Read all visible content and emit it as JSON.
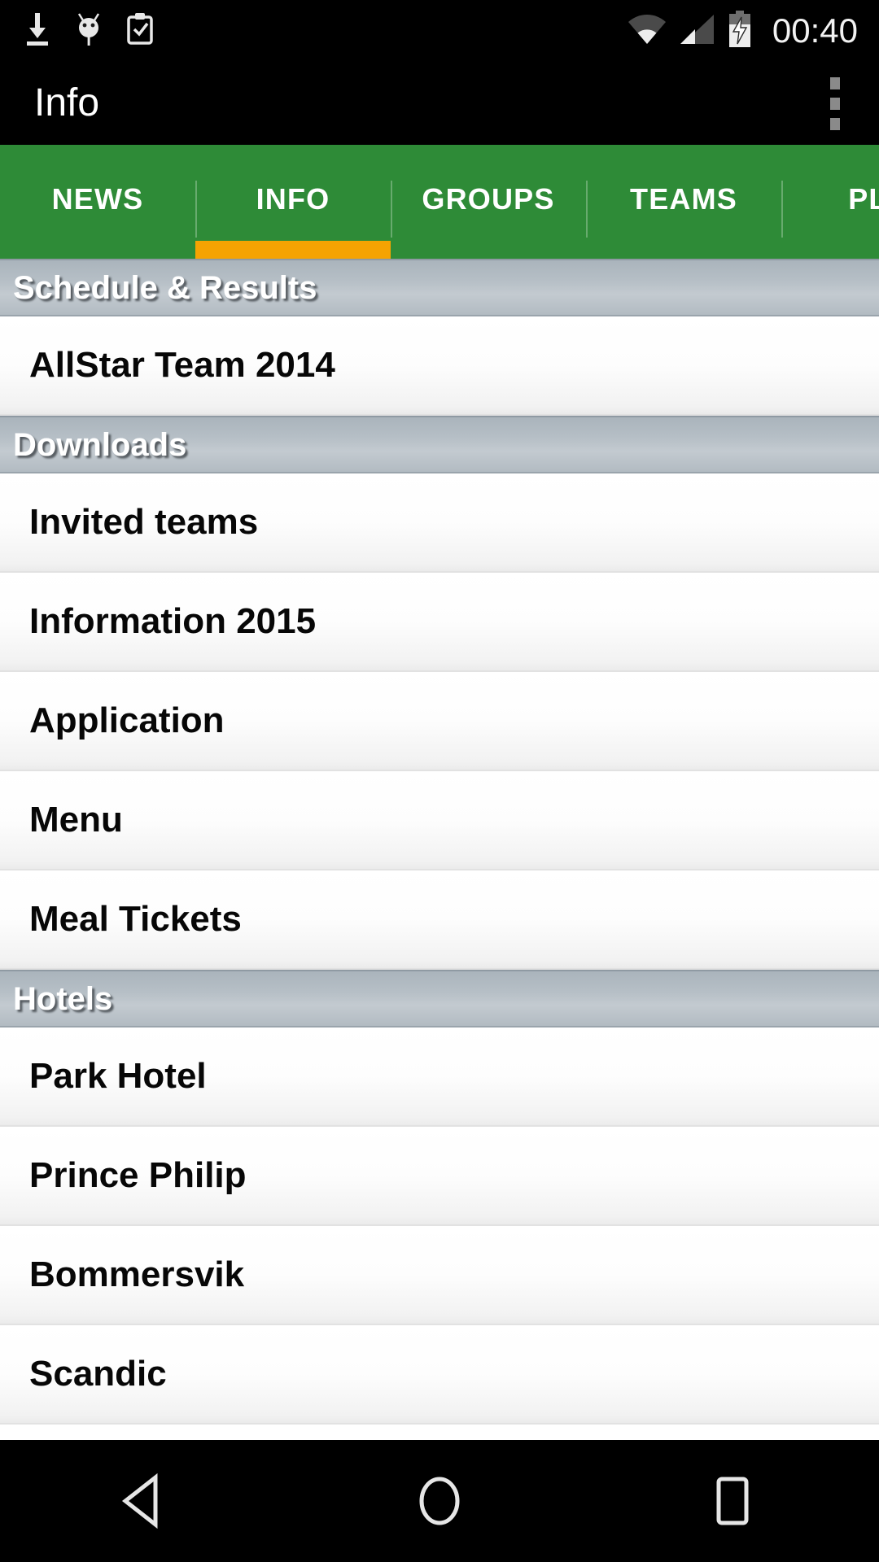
{
  "status_bar": {
    "icons_left": [
      "download-icon",
      "android-debug-icon",
      "clipboard-check-icon"
    ],
    "icons_right": [
      "wifi-icon",
      "cellular-signal-icon",
      "battery-charging-icon"
    ],
    "clock": "00:40"
  },
  "app_bar": {
    "title": "Info",
    "overflow_menu": "overflow-menu-icon"
  },
  "tabs": {
    "selected_index": 1,
    "accent_color": "#f5a302",
    "bar_color": "#2e8b37",
    "items": [
      {
        "label": "NEWS"
      },
      {
        "label": "INFO"
      },
      {
        "label": "GROUPS"
      },
      {
        "label": "TEAMS"
      },
      {
        "label": "PLA"
      }
    ]
  },
  "content": {
    "sections": [
      {
        "title": "Schedule & Results",
        "items": [
          {
            "label": "AllStar Team 2014"
          }
        ]
      },
      {
        "title": "Downloads",
        "items": [
          {
            "label": "Invited teams"
          },
          {
            "label": "Information 2015"
          },
          {
            "label": "Application"
          },
          {
            "label": "Menu"
          },
          {
            "label": "Meal Tickets"
          }
        ]
      },
      {
        "title": "Hotels",
        "items": [
          {
            "label": "Park Hotel"
          },
          {
            "label": "Prince Philip"
          },
          {
            "label": "Bommersvik"
          },
          {
            "label": "Scandic"
          }
        ]
      }
    ]
  },
  "nav_bar": {
    "buttons": [
      {
        "name": "back-icon"
      },
      {
        "name": "home-icon"
      },
      {
        "name": "recents-icon"
      }
    ]
  }
}
